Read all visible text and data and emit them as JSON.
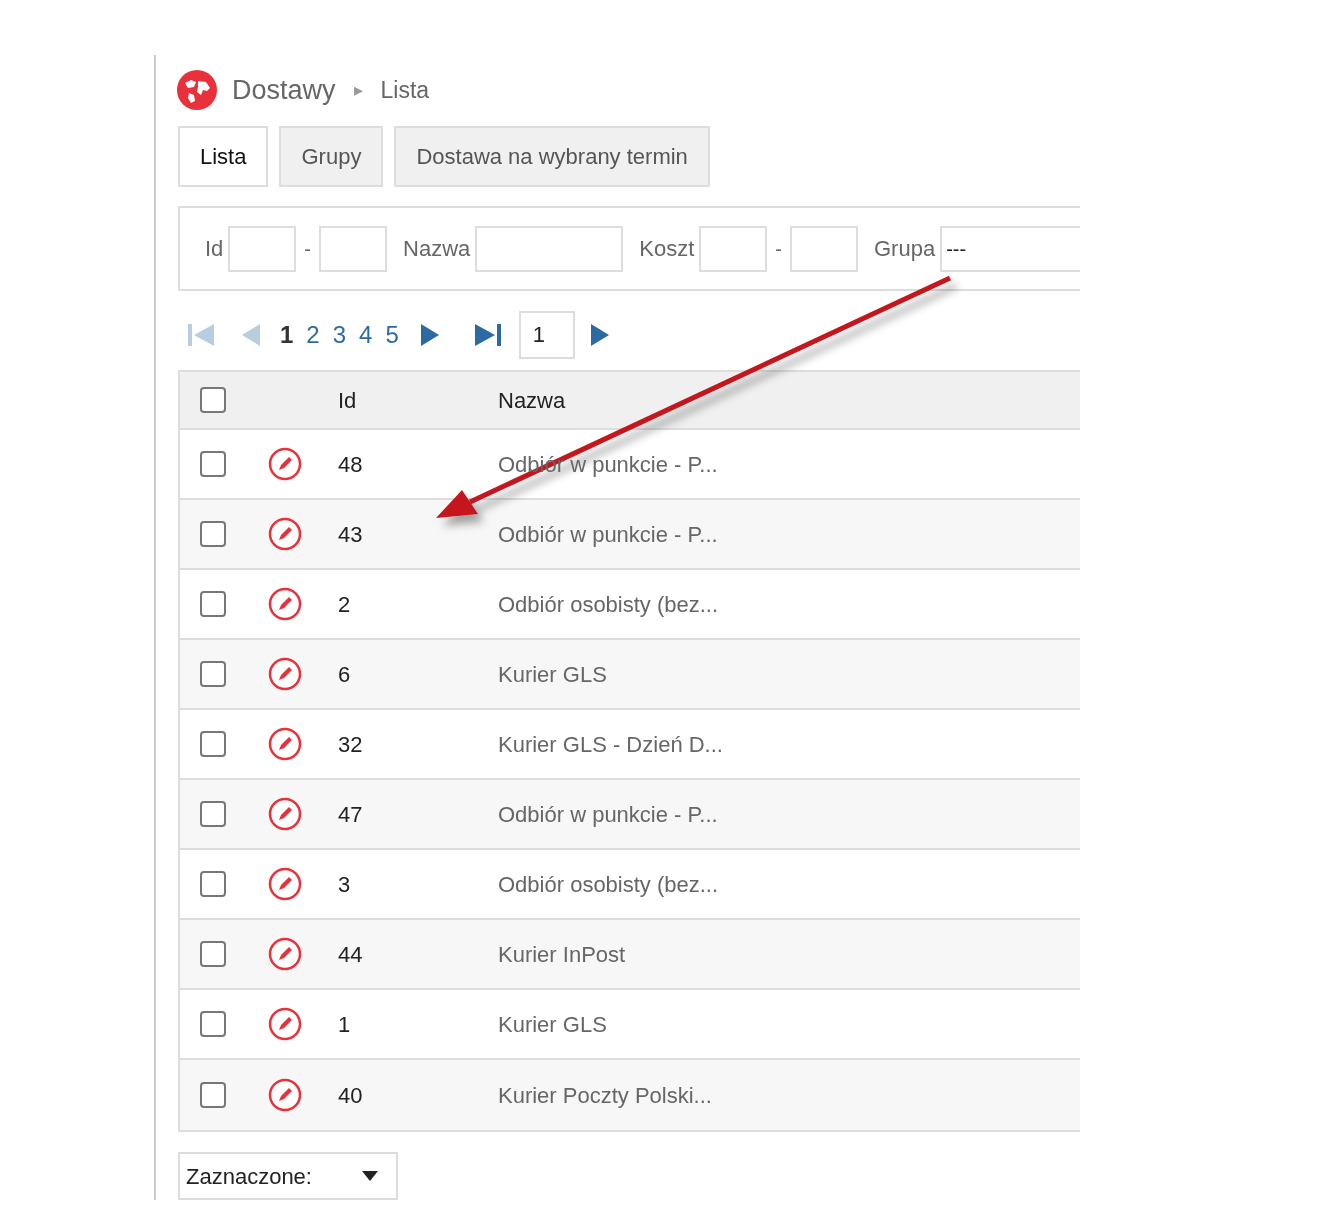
{
  "breadcrumb": {
    "section": "Dostawy",
    "separator": "▸",
    "page": "Lista"
  },
  "tabs": [
    {
      "label": "Lista",
      "selected": true
    },
    {
      "label": "Grupy",
      "selected": false
    },
    {
      "label": "Dostawa na wybrany termin",
      "selected": false
    }
  ],
  "filters": [
    {
      "kind": "range",
      "label": "Id",
      "separator": "-"
    },
    {
      "kind": "text",
      "label": "Nazwa"
    },
    {
      "kind": "range",
      "label": "Koszt",
      "separator": "-"
    },
    {
      "kind": "select",
      "label": "Grupa",
      "value": "---"
    }
  ],
  "pagination": {
    "first_disabled": true,
    "prev_disabled": true,
    "pages": [
      {
        "label": "1",
        "selected": true
      },
      {
        "label": "2",
        "selected": false
      },
      {
        "label": "3",
        "selected": false
      },
      {
        "label": "4",
        "selected": false
      },
      {
        "label": "5",
        "selected": false
      }
    ],
    "page_input": "1"
  },
  "table": {
    "header_checked": false,
    "columns": [
      "Id",
      "Nazwa"
    ],
    "rows": [
      {
        "checked": false,
        "id": "48",
        "name": "Odbiór w punkcie - P..."
      },
      {
        "checked": false,
        "id": "43",
        "name": "Odbiór w punkcie - P..."
      },
      {
        "checked": false,
        "id": "2",
        "name": "Odbiór osobisty (bez..."
      },
      {
        "checked": false,
        "id": "6",
        "name": "Kurier GLS"
      },
      {
        "checked": false,
        "id": "32",
        "name": "Kurier GLS - Dzień D..."
      },
      {
        "checked": false,
        "id": "47",
        "name": "Odbiór w punkcie - P..."
      },
      {
        "checked": false,
        "id": "3",
        "name": "Odbiór osobisty (bez..."
      },
      {
        "checked": false,
        "id": "44",
        "name": "Kurier InPost"
      },
      {
        "checked": false,
        "id": "1",
        "name": "Kurier GLS"
      },
      {
        "checked": false,
        "id": "40",
        "name": "Kurier Poczty Polski..."
      }
    ]
  },
  "bulk_action": {
    "value": "Zaznaczone:"
  }
}
